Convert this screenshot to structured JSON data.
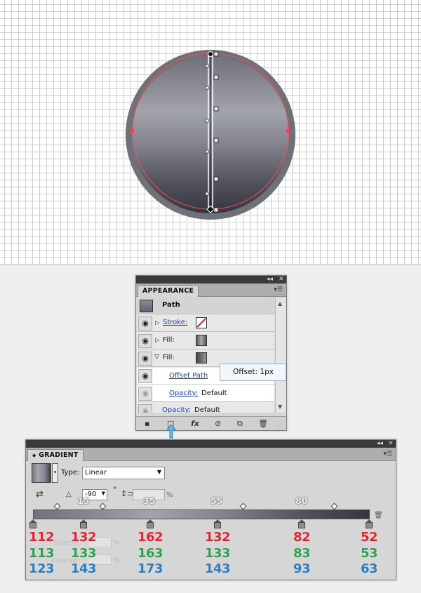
{
  "appearance": {
    "title": "APPEARANCE",
    "object_label": "Path",
    "rows": [
      {
        "name": "Stroke:",
        "kind": "stroke",
        "link": true
      },
      {
        "name": "Fill:",
        "kind": "fill",
        "link": false
      },
      {
        "name": "Fill:",
        "kind": "fill-open",
        "link": false
      }
    ],
    "offset_path_label": "Offset Path",
    "opacity_label": "Opacity:",
    "opacity_value": "Default",
    "opacity2_label": "Opacity:",
    "opacity2_value": "Default",
    "tooltip": "Offset: 1px"
  },
  "gradient": {
    "title": "GRADIENT",
    "type_label": "Type:",
    "type_value": "Linear",
    "angle_value": "-90",
    "degree_symbol": "°",
    "percent_symbol": "%",
    "opacity_label": "Opacity:",
    "location_label": "Location:",
    "location_labels": [
      "15",
      "35",
      "55",
      "80"
    ],
    "stops": [
      {
        "location": 0,
        "r": "112",
        "g": "113",
        "b": "123"
      },
      {
        "location": 15,
        "r": "132",
        "g": "133",
        "b": "143"
      },
      {
        "location": 35,
        "r": "162",
        "g": "163",
        "b": "173"
      },
      {
        "location": 55,
        "r": "132",
        "g": "133",
        "b": "143"
      },
      {
        "location": 80,
        "r": "82",
        "g": "83",
        "b": "93"
      },
      {
        "location": 100,
        "r": "52",
        "g": "53",
        "b": "63"
      }
    ],
    "colors": {
      "r": "#e2232f",
      "g": "#2aa24a",
      "b": "#2a7dc0"
    }
  },
  "icons": {
    "eye": "eye-icon",
    "panel_menu": "panel-menu-icon",
    "collapse": "collapse-icon",
    "close": "close-icon",
    "trash": "trash-icon"
  }
}
